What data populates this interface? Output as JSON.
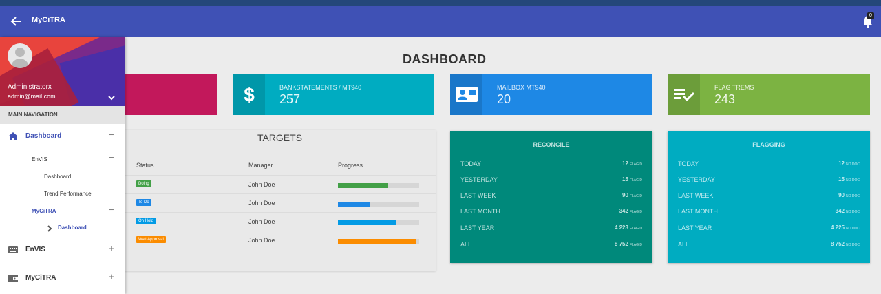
{
  "appbar": {
    "title": "MyCiTRA",
    "notification_count": "0"
  },
  "dashboard": {
    "title": "DASHBOARD"
  },
  "info_boxes": [
    {
      "label": "",
      "value": "",
      "color": "#c2185b"
    },
    {
      "label": "BANKSTATEMENTS / MT940",
      "value": "257",
      "color": "#00acc1",
      "icon": "dollar-icon"
    },
    {
      "label": "MAILBOX MT940",
      "value": "20",
      "color": "#1e88e5",
      "icon": "contact-card-icon"
    },
    {
      "label": "FLAG TREMS",
      "value": "243",
      "color": "#7cb342",
      "icon": "checklist-icon"
    }
  ],
  "targets": {
    "title": "TARGETS",
    "headers": {
      "status": "Status",
      "manager": "Manager",
      "progress": "Progress"
    },
    "rows": [
      {
        "status": "Doing",
        "status_color": "#43a047",
        "manager": "John Doe",
        "progress": 0.62,
        "bar_color": "#43a047"
      },
      {
        "status": "To Do",
        "status_color": "#1e88e5",
        "manager": "John Doe",
        "progress": 0.4,
        "bar_color": "#1e88e5"
      },
      {
        "status": "On Hold",
        "status_color": "#039be5",
        "manager": "John Doe",
        "progress": 0.72,
        "bar_color": "#039be5"
      },
      {
        "status": "Wait Approval",
        "status_color": "#fb8c00",
        "manager": "John Doe",
        "progress": 0.96,
        "bar_color": "#fb8c00"
      }
    ]
  },
  "reconcile": {
    "title": "RECONCILE",
    "color": "#00897b",
    "unit": "FLAGID",
    "rows": [
      {
        "label": "TODAY",
        "value": "12"
      },
      {
        "label": "YESTERDAY",
        "value": "15"
      },
      {
        "label": "LAST WEEK",
        "value": "90"
      },
      {
        "label": "LAST MONTH",
        "value": "342"
      },
      {
        "label": "LAST YEAR",
        "value": "4 223"
      },
      {
        "label": "ALL",
        "value": "8 752"
      }
    ]
  },
  "flagging": {
    "title": "FLAGGING",
    "color": "#00acc1",
    "unit": "NO DOC",
    "rows": [
      {
        "label": "TODAY",
        "value": "12"
      },
      {
        "label": "YESTERDAY",
        "value": "15"
      },
      {
        "label": "LAST WEEK",
        "value": "90"
      },
      {
        "label": "LAST MONTH",
        "value": "342"
      },
      {
        "label": "LAST YEAR",
        "value": "4 225"
      },
      {
        "label": "ALL",
        "value": "8 752"
      }
    ]
  },
  "sidebar": {
    "user_name": "Administratorx",
    "user_email": "admin@mail.com",
    "section": "MAIN NAVIGATION",
    "items": [
      {
        "label": "Dashboard",
        "toggle": "−",
        "icon": "home-icon"
      },
      {
        "label": "EnVIS",
        "toggle": "−"
      },
      {
        "label": "Dashboard"
      },
      {
        "label": "Trend Performance"
      },
      {
        "label": "MyCiTRA",
        "toggle": "−"
      },
      {
        "label": "Dashboard",
        "icon": "chevron-right-icon"
      },
      {
        "label": "EnVIS",
        "toggle": "+",
        "icon": "keyboard-icon"
      },
      {
        "label": "MyCiTRA",
        "toggle": "+",
        "icon": "wallet-icon"
      }
    ]
  }
}
